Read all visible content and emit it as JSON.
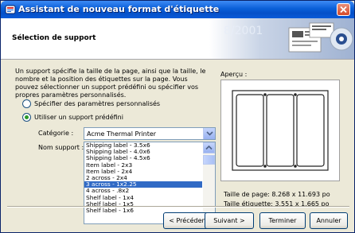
{
  "window": {
    "title": "Assistant de nouveau format d'étiquette"
  },
  "header": {
    "title": "Sélection de support",
    "art_text": "8/2001"
  },
  "body": {
    "description": "Un support spécifie la taille de la page, ainsi que la taille, le nombre et la position des étiquettes sur la page. Vous pouvez sélectionner un support prédéfini ou spécifier vos propres paramètres personnalisés.",
    "option_custom": "Spécifier des paramètres personnalisés",
    "option_predefined": "Utiliser un support prédéfini",
    "selected_option": "predefined",
    "category_label": "Catégorie :",
    "category_value": "Acme Thermal Printer",
    "support_name_label": "Nom support :",
    "support_list": [
      "Shipping label - 3.5x6",
      "Shipping label - 4.0x6",
      "Shipping label - 4.5x6",
      "Item label - 2x3",
      "Item label - 2x4",
      "2 across - 2x4",
      "3 across - 1x2.25",
      "4 across - .8x2",
      "Shelf label - 1x4",
      "Shelf label - 1x5",
      "Shelf label - 1x6"
    ],
    "selected_support": "3 across - 1x2.25"
  },
  "preview": {
    "label": "Aperçu :",
    "page_size": "Taille de page: 8.268 x 11.693 po",
    "label_size": "Taille étiquette: 3.551 x 1.665 po"
  },
  "buttons": {
    "back": "< Précédent",
    "next": "Suivant >",
    "finish": "Terminer",
    "cancel": "Annuler"
  },
  "colors": {
    "title_bar": "#0a5fd8",
    "selection": "#316ac5",
    "radio_dot": "#2a9a2a"
  }
}
